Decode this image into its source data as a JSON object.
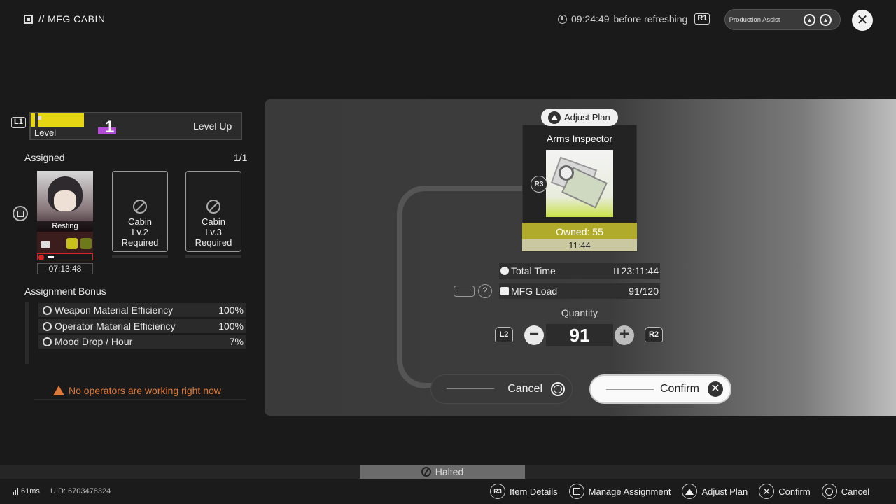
{
  "header": {
    "title": "// MFG CABIN",
    "refresh_time": "09:24:49",
    "refresh_label": "before refreshing",
    "r1_key": "R1",
    "production_assist": "Production Assist"
  },
  "level": {
    "key": "L1",
    "label": "Level",
    "value": "1",
    "level_up": "Level Up"
  },
  "assigned": {
    "label": "Assigned",
    "count": "1/1",
    "operator": {
      "status": "Resting",
      "timer": "07:13:48",
      "mood_fraction": 0.1
    },
    "slots": [
      {
        "line1": "Cabin",
        "line2": "Lv.2",
        "line3": "Required"
      },
      {
        "line1": "Cabin",
        "line2": "Lv.3",
        "line3": "Required"
      }
    ]
  },
  "bonus": {
    "title": "Assignment Bonus",
    "rows": [
      {
        "label": "Weapon Material Efficiency",
        "value": "100%"
      },
      {
        "label": "Operator Material Efficiency",
        "value": "100%"
      },
      {
        "label": "Mood Drop / Hour",
        "value": "7%"
      }
    ]
  },
  "warning": "No operators are working right now",
  "plan": {
    "adjust_plan": "Adjust Plan",
    "item_name": "Arms Inspector",
    "owned": "Owned: 55",
    "item_time": "11:44",
    "r3_key": "R3",
    "total_time_label": "Total Time",
    "total_time_value": "23:11:44",
    "mfg_load_label": "MFG Load",
    "mfg_load_value": "91/120",
    "help": "?",
    "quantity_label": "Quantity",
    "quantity_value": "91",
    "l2_key": "L2",
    "r2_key": "R2",
    "minus": "−",
    "plus": "+",
    "cancel": "Cancel",
    "confirm": "Confirm"
  },
  "status_bar": {
    "halted": "Halted"
  },
  "footer": {
    "ping": "61ms",
    "uid": "UID: 6703478324",
    "legend": [
      {
        "key": "R3",
        "label": "Item Details"
      },
      {
        "key": "square",
        "label": "Manage Assignment"
      },
      {
        "key": "triangle",
        "label": "Adjust Plan"
      },
      {
        "key": "cross",
        "label": "Confirm"
      },
      {
        "key": "circle",
        "label": "Cancel"
      }
    ]
  }
}
